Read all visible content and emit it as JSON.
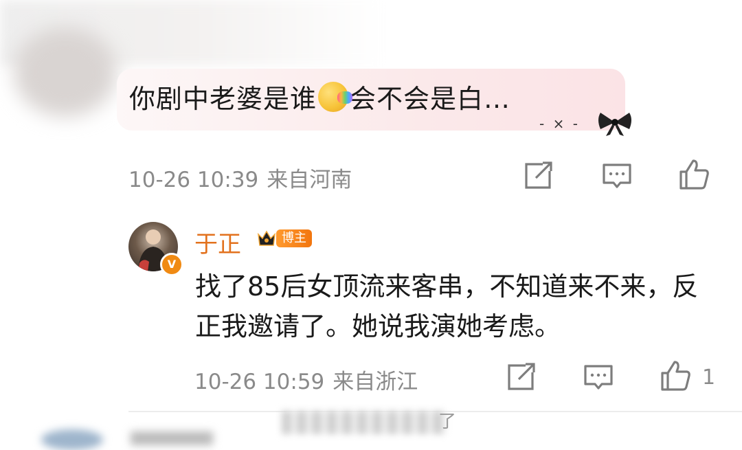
{
  "comment": {
    "text_before_emoji": "你剧中老婆是谁",
    "emoji_name": "rainbow-vomit-emoji",
    "text_after_emoji": "会不会是白…",
    "decoration": "- × -",
    "time": "10-26 10:39",
    "location": "来自河南"
  },
  "reply": {
    "username": "于正",
    "badge": "博主",
    "verified_mark": "V",
    "text": "找了85后女顶流来客串，不知道来不来，反正我邀请了。她说我演她考虑。",
    "time": "10-26 10:59",
    "location": "来自浙江",
    "like_count": "1"
  },
  "footer": {
    "partial_text": "了"
  },
  "colors": {
    "username": "#e2711d",
    "badge_bg": "#f2760f",
    "meta_text": "#8a8a8a",
    "bubble_bg": "#fbe9ea"
  }
}
